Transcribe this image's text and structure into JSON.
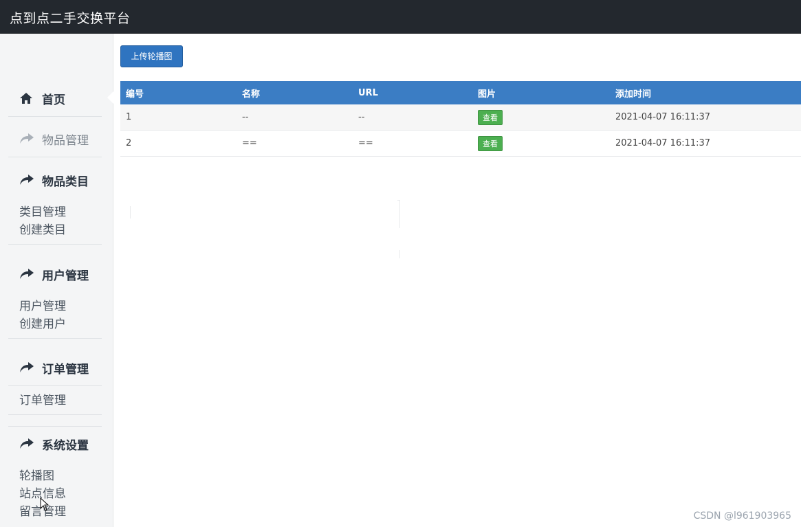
{
  "app": {
    "title": "点到点二手交换平台"
  },
  "sidebar": {
    "home": {
      "label": "首页",
      "icon": "home-icon"
    },
    "goods": {
      "label": "物品管理",
      "icon": "share-arrow-icon"
    },
    "category": {
      "label": "物品类目",
      "icon": "share-arrow-icon",
      "links": [
        "类目管理",
        "创建类目"
      ]
    },
    "users": {
      "label": "用户管理",
      "icon": "share-arrow-icon",
      "links": [
        "用户管理",
        "创建用户"
      ]
    },
    "orders": {
      "label": "订单管理",
      "icon": "share-arrow-icon",
      "links": [
        "订单管理"
      ]
    },
    "system": {
      "label": "系统设置",
      "icon": "share-arrow-icon",
      "links": [
        "轮播图",
        "站点信息",
        "留言管理"
      ]
    }
  },
  "toolbar": {
    "upload_label": "上传轮播图"
  },
  "table": {
    "headers": [
      "编号",
      "名称",
      "URL",
      "图片",
      "添加时间"
    ],
    "rows": [
      {
        "id": "1",
        "name": "--",
        "url": "--",
        "image_action": "查看",
        "time": "2021-04-07 16:11:37"
      },
      {
        "id": "2",
        "name": "==",
        "url": "==",
        "image_action": "查看",
        "time": "2021-04-07 16:11:37"
      }
    ]
  },
  "watermark": "CSDN @l961903965",
  "colors": {
    "topbar": "#23282e",
    "header": "#3b7dc4",
    "button": "#2f74c0",
    "view": "#4caf50"
  }
}
